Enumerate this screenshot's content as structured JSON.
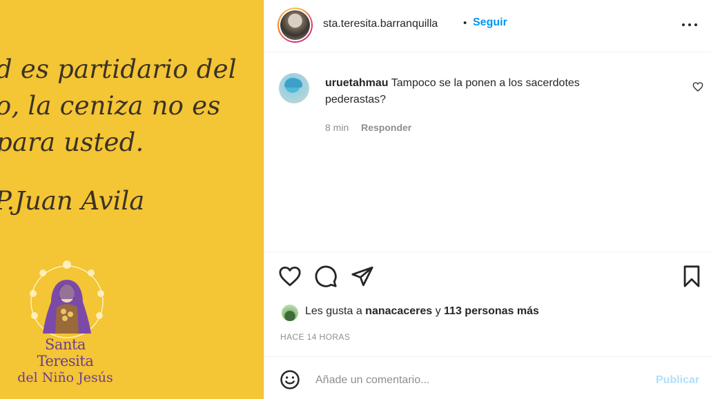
{
  "post_image": {
    "quote_lines": [
      "d es partidario del",
      "o, la ceniza no es",
      "para usted."
    ],
    "author": "P.Juan Avila",
    "logo_line1": "Santa Teresita",
    "logo_line2": "del Niño Jesús",
    "background_color": "#f4c534"
  },
  "header": {
    "username": "sta.teresita.barranquilla",
    "separator": "•",
    "follow_label": "Seguir",
    "more_icon": "more-horizontal-icon"
  },
  "comment": {
    "username": "uruetahmau",
    "text": "Tampoco se la ponen a los sacerdotes pederastas?",
    "age": "8 min",
    "reply_label": "Responder",
    "like_icon": "heart-icon"
  },
  "actions": {
    "like_icon": "heart-icon",
    "comment_icon": "comment-bubble-icon",
    "share_icon": "paper-plane-icon",
    "save_icon": "bookmark-icon"
  },
  "likes": {
    "prefix": "Les gusta a ",
    "first_user": "nanacaceres",
    "middle": " y ",
    "others": "113 personas más"
  },
  "timestamp": "HACE 14 HORAS",
  "add_comment": {
    "placeholder": "Añade un comentario...",
    "publish_label": "Publicar",
    "emoji_icon": "smiley-icon"
  },
  "colors": {
    "link_blue": "#0095f6",
    "publish_disabled": "#b2dffc",
    "logo_purple": "#6a3d92"
  }
}
